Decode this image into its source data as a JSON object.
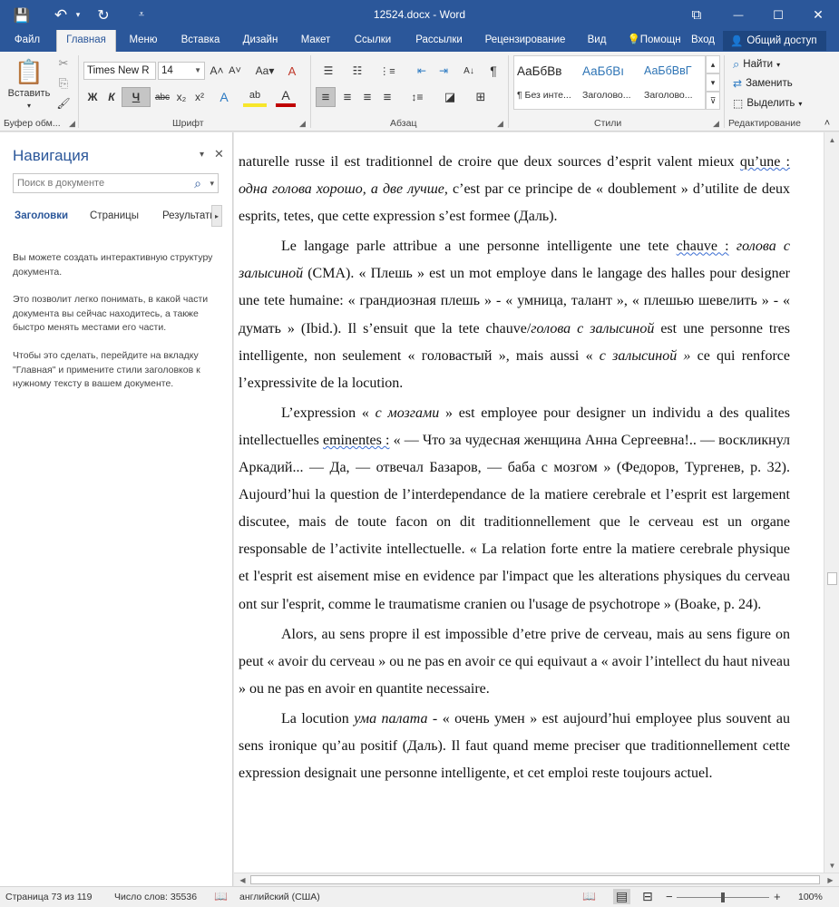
{
  "titlebar": {
    "title": "12524.docx - Word",
    "save_icon": "💾",
    "undo_icon": "↶",
    "undo_dd": "▾",
    "redo_icon": "↻",
    "customize_icon": "⩡",
    "ribbon_display_icon": "⧉",
    "minimize_icon": "—",
    "maximize_icon": "☐",
    "close_icon": "✕"
  },
  "tabs": {
    "items": [
      "Файл",
      "Главная",
      "Меню",
      "Вставка",
      "Дизайн",
      "Макет",
      "Ссылки",
      "Рассылки",
      "Рецензирование",
      "Вид"
    ],
    "tellme": "Помощн",
    "signin": "Вход",
    "share": "Общий доступ"
  },
  "ribbon": {
    "clipboard": {
      "paste_label": "Вставить",
      "paste_arrow": "▾",
      "group_label": "Буфер обм...",
      "cut_icon": "✂",
      "copy_icon": "⎘",
      "format_painter_icon": "🖌"
    },
    "font": {
      "font_name": "Times New R",
      "font_size": "14",
      "grow": "A˄",
      "shrink": "A˅",
      "change_case": "Aa▾",
      "clear_format": "A",
      "bold": "Ж",
      "italic": "К",
      "underline": "Ч",
      "strike": "abc",
      "subscript": "x₂",
      "superscript": "x²",
      "text_effects": "A",
      "highlight": "ab",
      "font_color": "A",
      "group_label": "Шрифт"
    },
    "paragraph": {
      "group_label": "Абзац",
      "bullets": "☰",
      "numbering": "☷",
      "multilevel": "⋮≡",
      "dec_indent": "⇤",
      "inc_indent": "⇥",
      "sort": "A↓",
      "show_marks": "¶",
      "align_left": "≡",
      "align_center": "≡",
      "align_right": "≡",
      "justify": "≡",
      "line_spacing": "↕≡",
      "shading": "◪",
      "borders": "⊞"
    },
    "styles": {
      "group_label": "Стили",
      "items": [
        {
          "sample": "АаБбВв",
          "name": "¶ Без инте..."
        },
        {
          "sample": "АаБбВı",
          "name": "Заголово..."
        },
        {
          "sample": "АаБбВвГ",
          "name": "Заголово..."
        }
      ],
      "up_icon": "▴",
      "down_icon": "▾",
      "more_icon": "⊽"
    },
    "editing": {
      "group_label": "Редактирование",
      "find": "Найти",
      "find_arrow": "▾",
      "replace": "Заменить",
      "select": "Выделить",
      "select_arrow": "▾",
      "find_icon": "⌕",
      "replace_icon": "⇄",
      "select_icon": "⬚",
      "collapse_icon": "˄"
    }
  },
  "nav": {
    "title": "Навигация",
    "menu_icon": "▾",
    "close_icon": "✕",
    "search_placeholder": "Поиск в документе",
    "search_icon": "⌕",
    "search_dd": "▾",
    "tabs": [
      "Заголовки",
      "Страницы",
      "Результаты"
    ],
    "tabs_more": "▸",
    "help": [
      "Вы можете создать интерактивную структуру документа.",
      "Это позволит легко понимать, в какой части документа вы сейчас находитесь, а также быстро менять местами его части.",
      "Чтобы это сделать, перейдите на вкладку \"Главная\" и примените стили заголовков к нужному тексту в вашем документе."
    ]
  },
  "doc": {
    "p1": {
      "a": "naturelle russe il est traditionnel de croire que deux sources d’esprit valent mieux ",
      "b": "qu’une :",
      "c": " ",
      "d": "одна голова хорошо, а две лучше,",
      "e": " c’est par ce principe de « doublement » d’utilite de deux esprits, tetes, que cette expression s’est formee (Даль)."
    },
    "p2": {
      "a": "Le langage parle attribue a une personne intelligente une tete ",
      "b": "chauve :",
      "c": " ",
      "d": "голова с залысиной",
      "e": " (СМА). « Плешь » est un mot employe dans le langage des halles pour designer une tete humaine: « грандиозная плешь » - « умница, талант », « плешью шевелить » - « думать » (Ibid.). Il s’ensuit que la tete chauve/",
      "f": "голова с залысиной",
      "g": " est une personne tres intelligente, non seulement « головастый », mais aussi « ",
      "h": "с залысиной »",
      "i": " ce qui renforce l’expressivite de la locution."
    },
    "p3": {
      "a": "L’expression « ",
      "b": "с мозгами",
      "c": " » est employee pour designer un individu a des qualites intellectuelles ",
      "d": "eminentes :",
      "e": " « — Что за чудесная женщина Анна Сергеевна!.. — воскликнул Аркадий... — Да, — отвечал Базаров, — баба с мозгом » (Федоров, Тургенев, p. 32). Aujourd’hui la question de l’interdependance de la matiere cerebrale et l’esprit est largement discutee, mais de toute facon on dit traditionnellement que le cerveau est un organe responsable de l’activite intellectuelle. « La relation forte entre la matiere cerebrale physique et l'esprit est aisement mise en evidence par l'impact que les alterations physiques du cerveau ont sur l'esprit, comme le traumatisme cranien ou l'usage de psychotrope » (Boake, p. 24)."
    },
    "p4": "Alors, au sens propre il est impossible d’etre prive de cerveau, mais au sens figure on peut « avoir du cerveau » ou ne pas en avoir ce qui equivaut a « avoir l’intellect du haut niveau » ou ne pas en avoir en quantite necessaire.",
    "p5": {
      "a": "La locution ",
      "b": "ума палата",
      "c": " - « очень умен » est aujourd’hui employee plus souvent au sens ironique qu’au positif (Даль). Il faut quand meme preciser que traditionnellement cette expression designait une personne intelligente, et cet emploi reste toujours actuel."
    }
  },
  "scroll": {
    "up": "▲",
    "down": "▼",
    "left": "◀",
    "right": "▶"
  },
  "status": {
    "page": "Страница 73 из 119",
    "words": "Число слов: 35536",
    "proof_icon": "📖",
    "language": "английский (США)",
    "read_mode_icon": "📖",
    "print_layout_icon": "▤",
    "web_layout_icon": "⊟",
    "zoom_out": "−",
    "zoom_in": "+",
    "zoom": "100%"
  }
}
